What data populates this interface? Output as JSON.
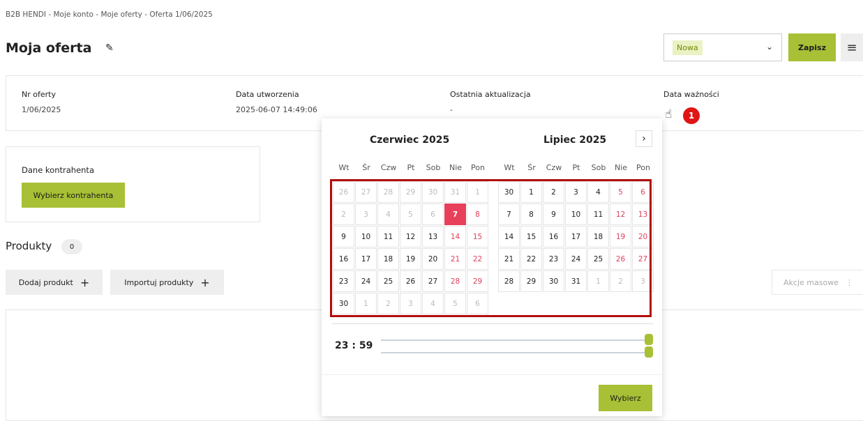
{
  "breadcrumb": "B2B HENDI  -  Moje konto  -  Moje oferty  -  Oferta 1/06/2025",
  "header": {
    "title": "Moja oferta",
    "status_value": "Nowa",
    "save_label": "Zapisz"
  },
  "info": {
    "offer_no_label": "Nr oferty",
    "offer_no": "1/06/2025",
    "created_label": "Data utworzenia",
    "created": "2025-06-07 14:49:06",
    "updated_label": "Ostatnia aktualizacja",
    "updated": "-",
    "expiry_label": "Data ważności"
  },
  "step_badge": "1",
  "client": {
    "label": "Dane kontrahenta",
    "button": "Wybierz kontrahenta"
  },
  "products": {
    "title": "Produkty",
    "count": "0",
    "add_label": "Dodaj produkt",
    "import_label": "Importuj produkty",
    "bulk_label": "Akcje masowe"
  },
  "picker": {
    "weekdays": [
      "Wt",
      "Śr",
      "Czw",
      "Pt",
      "Sob",
      "Nie",
      "Pon"
    ],
    "months": [
      {
        "title": "Czerwiec  2025",
        "days": [
          {
            "d": "26",
            "m": true
          },
          {
            "d": "27",
            "m": true
          },
          {
            "d": "28",
            "m": true
          },
          {
            "d": "29",
            "m": true
          },
          {
            "d": "30",
            "m": true
          },
          {
            "d": "31",
            "m": true
          },
          {
            "d": "1",
            "m": true
          },
          {
            "d": "2",
            "m": true
          },
          {
            "d": "3",
            "m": true
          },
          {
            "d": "4",
            "m": true
          },
          {
            "d": "5",
            "m": true
          },
          {
            "d": "6",
            "m": true
          },
          {
            "d": "7",
            "sel": true
          },
          {
            "d": "8",
            "w": true
          },
          {
            "d": "9"
          },
          {
            "d": "10"
          },
          {
            "d": "11"
          },
          {
            "d": "12"
          },
          {
            "d": "13"
          },
          {
            "d": "14",
            "w": true
          },
          {
            "d": "15",
            "w": true
          },
          {
            "d": "16"
          },
          {
            "d": "17"
          },
          {
            "d": "18"
          },
          {
            "d": "19"
          },
          {
            "d": "20"
          },
          {
            "d": "21",
            "w": true
          },
          {
            "d": "22",
            "w": true
          },
          {
            "d": "23"
          },
          {
            "d": "24"
          },
          {
            "d": "25"
          },
          {
            "d": "26"
          },
          {
            "d": "27"
          },
          {
            "d": "28",
            "w": true
          },
          {
            "d": "29",
            "w": true
          },
          {
            "d": "30"
          },
          {
            "d": "1",
            "m": true
          },
          {
            "d": "2",
            "m": true
          },
          {
            "d": "3",
            "m": true
          },
          {
            "d": "4",
            "m": true
          },
          {
            "d": "5",
            "m": true
          },
          {
            "d": "6",
            "m": true
          }
        ]
      },
      {
        "title": "Lipiec  2025",
        "days": [
          {
            "d": "30"
          },
          {
            "d": "1"
          },
          {
            "d": "2"
          },
          {
            "d": "3"
          },
          {
            "d": "4"
          },
          {
            "d": "5",
            "w": true
          },
          {
            "d": "6",
            "w": true
          },
          {
            "d": "7"
          },
          {
            "d": "8"
          },
          {
            "d": "9"
          },
          {
            "d": "10"
          },
          {
            "d": "11"
          },
          {
            "d": "12",
            "w": true
          },
          {
            "d": "13",
            "w": true
          },
          {
            "d": "14"
          },
          {
            "d": "15"
          },
          {
            "d": "16"
          },
          {
            "d": "17"
          },
          {
            "d": "18"
          },
          {
            "d": "19",
            "w": true
          },
          {
            "d": "20",
            "w": true
          },
          {
            "d": "21"
          },
          {
            "d": "22"
          },
          {
            "d": "23"
          },
          {
            "d": "24"
          },
          {
            "d": "25"
          },
          {
            "d": "26",
            "w": true
          },
          {
            "d": "27",
            "w": true
          },
          {
            "d": "28"
          },
          {
            "d": "29"
          },
          {
            "d": "30"
          },
          {
            "d": "31"
          },
          {
            "d": "1",
            "m": true
          },
          {
            "d": "2",
            "m": true
          },
          {
            "d": "3",
            "m": true
          }
        ]
      }
    ],
    "hour": "23",
    "minute": "59",
    "choose_label": "Wybierz"
  },
  "colors": {
    "accent": "#a8c035",
    "selected": "#e8405a",
    "highlight_box": "#b10d0d"
  }
}
